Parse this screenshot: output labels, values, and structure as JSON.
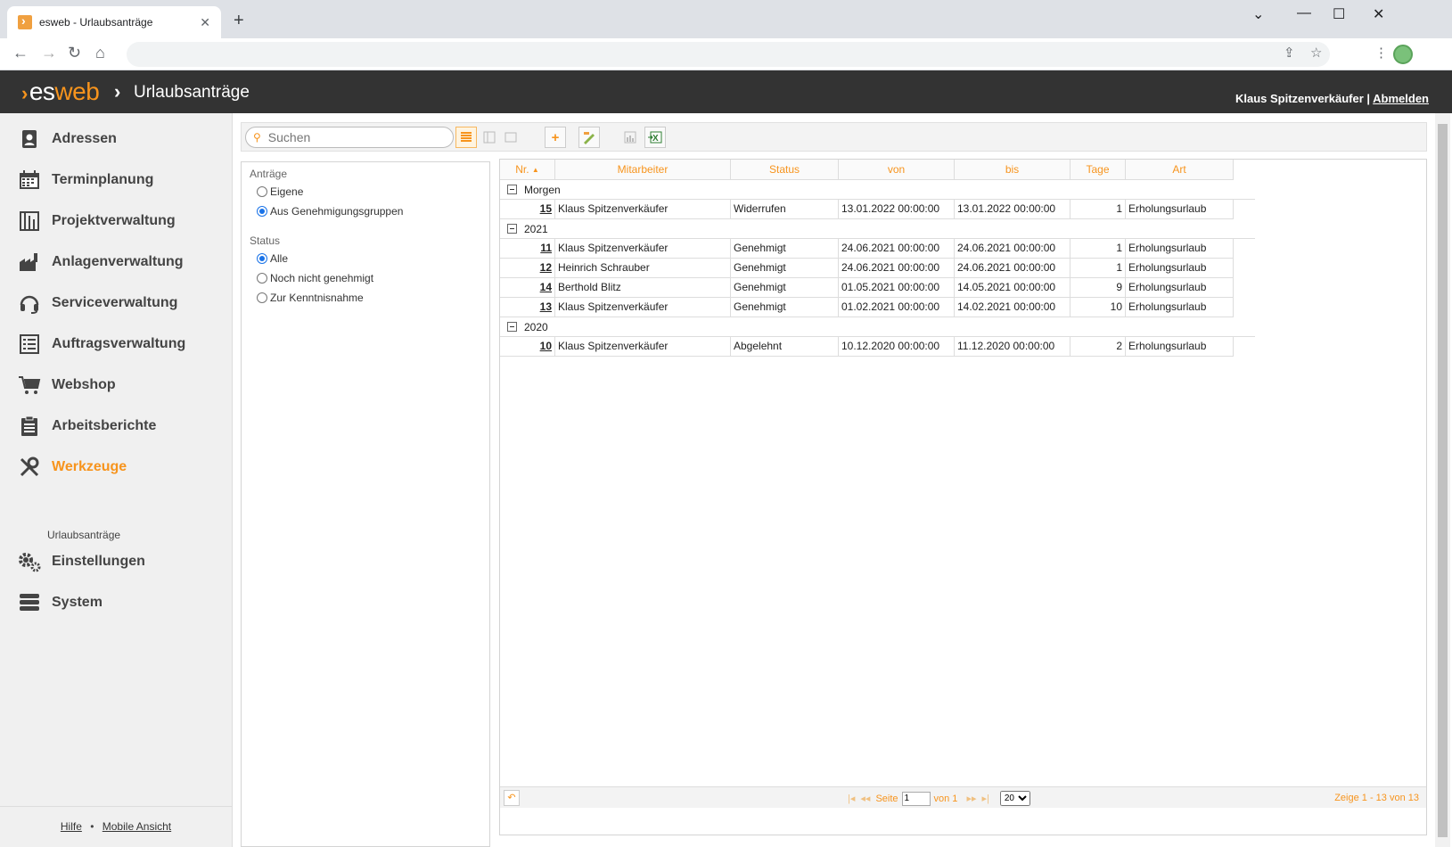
{
  "browser": {
    "tab_title": "esweb - Urlaubsanträge",
    "tab_close": "✕",
    "new_tab": "+",
    "minimize": "⌄",
    "restore": "—",
    "maximize": "☐",
    "close": "✕"
  },
  "header": {
    "logo_es": "es",
    "logo_web": "web",
    "separator": "›",
    "title": "Urlaubsanträge",
    "user": "Klaus Spitzenverkäufer",
    "user_sep": " | ",
    "logout": "Abmelden"
  },
  "sidebar": {
    "items": [
      {
        "label": "Adressen",
        "icon": "address-book-icon"
      },
      {
        "label": "Terminplanung",
        "icon": "calendar-icon"
      },
      {
        "label": "Projektverwaltung",
        "icon": "project-icon"
      },
      {
        "label": "Anlagenverwaltung",
        "icon": "factory-icon"
      },
      {
        "label": "Serviceverwaltung",
        "icon": "headset-icon"
      },
      {
        "label": "Auftragsverwaltung",
        "icon": "list-icon"
      },
      {
        "label": "Webshop",
        "icon": "cart-icon"
      },
      {
        "label": "Arbeitsberichte",
        "icon": "clipboard-icon"
      },
      {
        "label": "Werkzeuge",
        "icon": "tools-icon",
        "active": true
      },
      {
        "label": "Einstellungen",
        "icon": "gears-icon"
      },
      {
        "label": "System",
        "icon": "server-icon"
      }
    ],
    "sub_item": "Urlaubsanträge",
    "footer_help": "Hilfe",
    "footer_sep": "•",
    "footer_mobile": "Mobile Ansicht"
  },
  "toolbar": {
    "search_placeholder": "Suchen"
  },
  "filter": {
    "antraege_heading": "Anträge",
    "antraege_options": [
      "Eigene",
      "Aus Genehmigungsgruppen"
    ],
    "antraege_selected": "Aus Genehmigungsgruppen",
    "status_heading": "Status",
    "status_options": [
      "Alle",
      "Noch nicht genehmigt",
      "Zur Kenntnisnahme"
    ],
    "status_selected": "Alle"
  },
  "grid": {
    "columns": [
      "Nr.",
      "Mitarbeiter",
      "Status",
      "von",
      "bis",
      "Tage",
      "Art"
    ],
    "sort_indicator": "▲",
    "groups": [
      {
        "label": "Morgen",
        "rows": [
          {
            "nr": "15",
            "mitarbeiter": "Klaus Spitzenverkäufer",
            "status": "Widerrufen",
            "von": "13.01.2022 00:00:00",
            "bis": "13.01.2022 00:00:00",
            "tage": "1",
            "art": "Erholungsurlaub"
          }
        ]
      },
      {
        "label": "2021",
        "rows": [
          {
            "nr": "11",
            "mitarbeiter": "Klaus Spitzenverkäufer",
            "status": "Genehmigt",
            "von": "24.06.2021 00:00:00",
            "bis": "24.06.2021 00:00:00",
            "tage": "1",
            "art": "Erholungsurlaub"
          },
          {
            "nr": "12",
            "mitarbeiter": "Heinrich Schrauber",
            "status": "Genehmigt",
            "von": "24.06.2021 00:00:00",
            "bis": "24.06.2021 00:00:00",
            "tage": "1",
            "art": "Erholungsurlaub"
          },
          {
            "nr": "14",
            "mitarbeiter": "Berthold Blitz",
            "status": "Genehmigt",
            "von": "01.05.2021 00:00:00",
            "bis": "14.05.2021 00:00:00",
            "tage": "9",
            "art": "Erholungsurlaub"
          },
          {
            "nr": "13",
            "mitarbeiter": "Klaus Spitzenverkäufer",
            "status": "Genehmigt",
            "von": "01.02.2021 00:00:00",
            "bis": "14.02.2021 00:00:00",
            "tage": "10",
            "art": "Erholungsurlaub"
          }
        ]
      },
      {
        "label": "2020",
        "rows": [
          {
            "nr": "10",
            "mitarbeiter": "Klaus Spitzenverkäufer",
            "status": "Abgelehnt",
            "von": "10.12.2020 00:00:00",
            "bis": "11.12.2020 00:00:00",
            "tage": "2",
            "art": "Erholungsurlaub"
          }
        ]
      }
    ],
    "pager": {
      "first": "|◂",
      "prev": "◂◂",
      "page_label": "Seite",
      "page_value": "1",
      "of_label": "von 1",
      "next": "▸▸",
      "last": "▸|",
      "page_size": "20",
      "showing": "Zeige 1 - 13 von 13"
    }
  },
  "colors": {
    "accent": "#f7941d",
    "header_bg": "#333333",
    "sidebar_bg": "#f0f0f0"
  }
}
